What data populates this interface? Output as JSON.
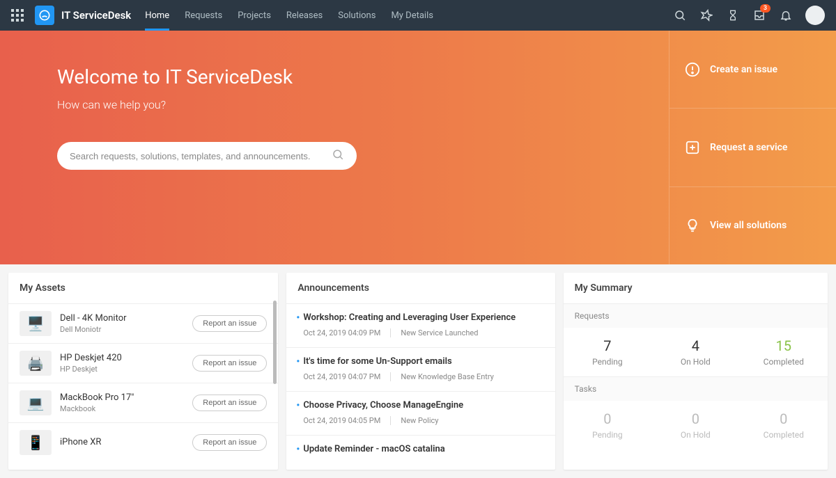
{
  "brand": "IT ServiceDesk",
  "nav": [
    "Home",
    "Requests",
    "Projects",
    "Releases",
    "Solutions",
    "My Details"
  ],
  "notification_badge": "3",
  "hero": {
    "title": "Welcome to IT ServiceDesk",
    "subtitle": "How can we help you?",
    "search_placeholder": "Search requests, solutions, templates, and announcements."
  },
  "actions": [
    {
      "label": "Create an issue"
    },
    {
      "label": "Request a service"
    },
    {
      "label": "View all solutions"
    }
  ],
  "assets": {
    "title": "My Assets",
    "report_label": "Report an issue",
    "items": [
      {
        "name": "Dell - 4K Monitor",
        "type": "Dell Moniotr",
        "icon": "🖥️"
      },
      {
        "name": "HP Deskjet 420",
        "type": "HP Deskjet",
        "icon": "🖨️"
      },
      {
        "name": "MackBook Pro 17\"",
        "type": "Mackbook",
        "icon": "💻"
      },
      {
        "name": "iPhone XR",
        "type": "",
        "icon": "📱"
      }
    ]
  },
  "announcements": {
    "title": "Announcements",
    "items": [
      {
        "title": "Workshop: Creating and Leveraging User Experience",
        "date": "Oct 24, 2019 04:09 PM",
        "tag": "New Service Launched"
      },
      {
        "title": "It's time for some Un-Support emails",
        "date": "Oct 24, 2019 04:07 PM",
        "tag": "New Knowledge Base Entry"
      },
      {
        "title": "Choose Privacy, Choose ManageEngine",
        "date": "Oct 24, 2019 04:05 PM",
        "tag": "New Policy"
      },
      {
        "title": "Update Reminder - macOS catalina",
        "date": "",
        "tag": ""
      }
    ]
  },
  "summary": {
    "title": "My Summary",
    "sections": [
      {
        "label": "Requests",
        "stats": [
          {
            "val": "7",
            "label": "Pending"
          },
          {
            "val": "4",
            "label": "On Hold"
          },
          {
            "val": "15",
            "label": "Completed",
            "green": true
          }
        ]
      },
      {
        "label": "Tasks",
        "stats": [
          {
            "val": "0",
            "label": "Pending",
            "muted": true
          },
          {
            "val": "0",
            "label": "On Hold",
            "muted": true
          },
          {
            "val": "0",
            "label": "Completed",
            "muted": true
          }
        ]
      }
    ]
  }
}
